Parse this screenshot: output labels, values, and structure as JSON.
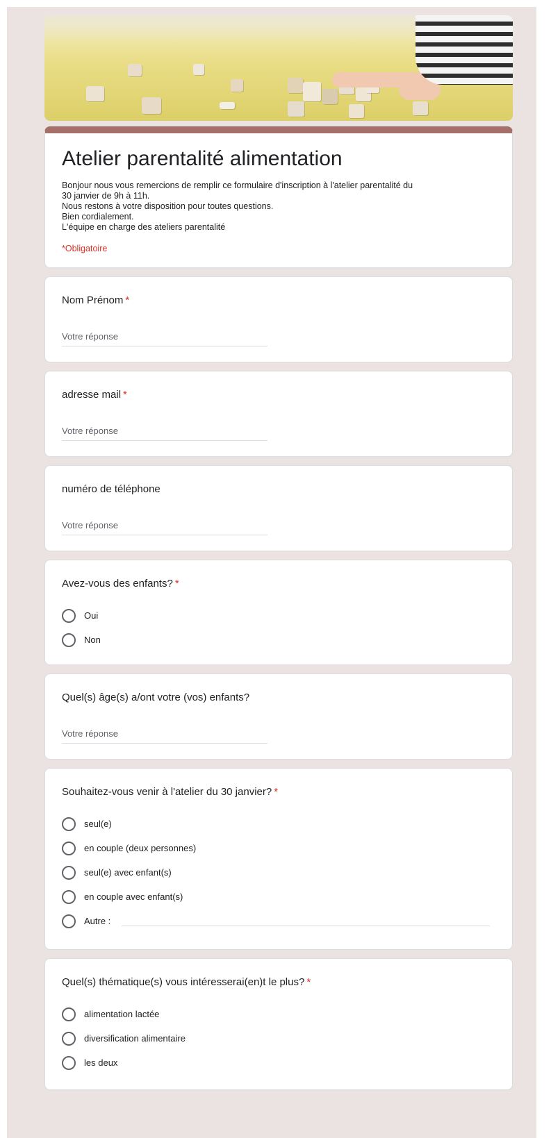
{
  "form": {
    "title": "Atelier parentalité alimentation",
    "description_lines": [
      "Bonjour nous vous remercions de remplir ce formulaire d'inscription à l'atelier parentalité du",
      "30 janvier de 9h à 11h.",
      "Nous restons à votre disposition pour toutes questions.",
      "Bien cordialement.",
      "L'équipe en charge des ateliers parentalité"
    ],
    "required_note": "*Obligatoire"
  },
  "questions": {
    "q1": {
      "label": "Nom Prénom",
      "required": "*",
      "placeholder": "Votre réponse"
    },
    "q2": {
      "label": "adresse mail",
      "required": "*",
      "placeholder": "Votre réponse"
    },
    "q3": {
      "label": "numéro de téléphone",
      "placeholder": "Votre réponse"
    },
    "q4": {
      "label": "Avez-vous des enfants?",
      "required": "*",
      "options": [
        "Oui",
        "Non"
      ]
    },
    "q5": {
      "label": "Quel(s) âge(s) a/ont votre (vos) enfants?",
      "placeholder": "Votre réponse"
    },
    "q6": {
      "label": "Souhaitez-vous venir à l'atelier du 30 janvier?",
      "required": "*",
      "options": [
        "seul(e)",
        "en couple (deux personnes)",
        "seul(e) avec enfant(s)",
        "en couple avec enfant(s)",
        "Autre :"
      ]
    },
    "q7": {
      "label": "Quel(s) thématique(s) vous intéresserai(en)t le plus?",
      "required": "*",
      "options": [
        "alimentation lactée",
        "diversification alimentaire",
        "les deux"
      ]
    }
  },
  "colors": {
    "accent": "#a5706a",
    "page_background": "#ebe3e1",
    "required": "#d93025"
  }
}
